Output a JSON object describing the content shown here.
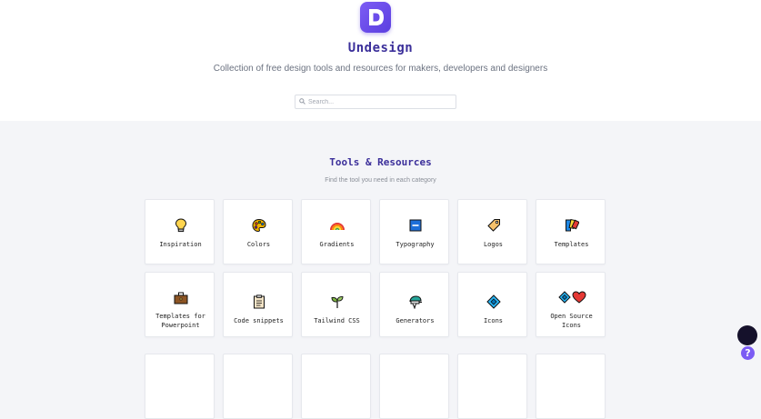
{
  "header": {
    "app_name": "Undesign",
    "tagline": "Collection of free design tools and resources for makers, developers and designers",
    "logo_letter": "D",
    "search": {
      "placeholder": "Search..."
    }
  },
  "section": {
    "title": "Tools & Resources",
    "subtitle": "Find the tool you need in each category"
  },
  "categories": [
    {
      "label": "Inspiration",
      "icon": "lightbulb-icon"
    },
    {
      "label": "Colors",
      "icon": "palette-icon"
    },
    {
      "label": "Gradients",
      "icon": "rainbow-icon"
    },
    {
      "label": "Typography",
      "icon": "abc-icon"
    },
    {
      "label": "Logos",
      "icon": "tag-icon"
    },
    {
      "label": "Templates",
      "icon": "swatches-icon"
    },
    {
      "label": "Templates for Powerpoint",
      "icon": "briefcase-icon"
    },
    {
      "label": "Code snippets",
      "icon": "clipboard-icon"
    },
    {
      "label": "Tailwind CSS",
      "icon": "seedling-icon"
    },
    {
      "label": "Generators",
      "icon": "generator-icon"
    },
    {
      "label": "Icons",
      "icon": "diamond-icon"
    },
    {
      "label": "Open Source Icons",
      "icon": "diamond-heart-icon"
    }
  ],
  "help_button": {
    "label": "?"
  },
  "colors": {
    "brand": "#6d4ef0",
    "heading": "#3b2f9a",
    "page_bg": "#f4f5f8"
  }
}
